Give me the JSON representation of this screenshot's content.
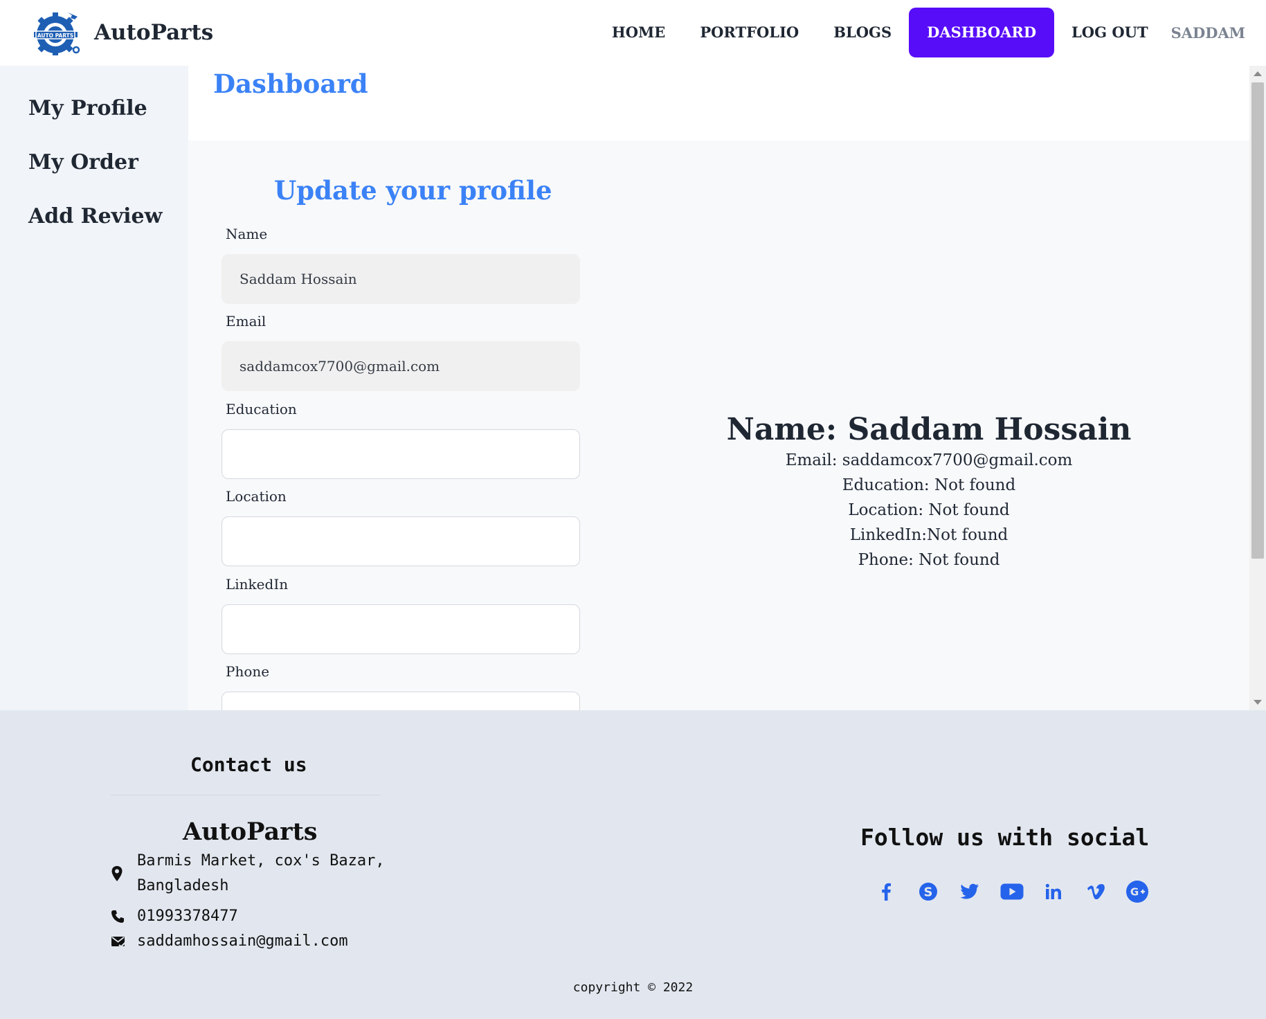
{
  "colors": {
    "accent": "#3b82f6",
    "active_nav": "#570df8",
    "social": "#2563eb"
  },
  "navbar": {
    "brand": "AutoParts",
    "logo_text": "AUTO PARTS",
    "links": [
      "HOME",
      "PORTFOLIO",
      "BLOGS",
      "DASHBOARD",
      "LOG OUT"
    ],
    "active": "DASHBOARD",
    "user": "SADDAM"
  },
  "sidebar": {
    "items": [
      {
        "label": "My Profile"
      },
      {
        "label": "My Order"
      },
      {
        "label": "Add Review"
      }
    ]
  },
  "dashboard": {
    "title": "Dashboard"
  },
  "form": {
    "title": "Update your profile",
    "fields": [
      {
        "label": "Name",
        "value": "Saddam Hossain"
      },
      {
        "label": "Email",
        "value": "saddamcox7700@gmail.com"
      },
      {
        "label": "Education",
        "value": ""
      },
      {
        "label": "Location",
        "value": ""
      },
      {
        "label": "LinkedIn",
        "value": ""
      },
      {
        "label": "Phone",
        "value": ""
      }
    ]
  },
  "profile": {
    "name": "Name: Saddam Hossain",
    "email": "Email: saddamcox7700@gmail.com",
    "education": "Education: Not found",
    "location": "Location: Not found",
    "linkedin": "LinkedIn:Not found",
    "phone": "Phone: Not found"
  },
  "footer": {
    "contact_title": "Contact us",
    "brand": "AutoParts",
    "address_line1": "Barmis Market, cox's Bazar,",
    "address_line2": "Bangladesh",
    "phone": "01993378477",
    "email": "saddamhossain@gmail.com",
    "social_title": "Follow us with social",
    "social_icons": [
      "facebook-icon",
      "skype-icon",
      "twitter-icon",
      "youtube-icon",
      "linkedin-icon",
      "vimeo-icon",
      "google-plus-icon"
    ],
    "copyright": "copyright © 2022"
  }
}
